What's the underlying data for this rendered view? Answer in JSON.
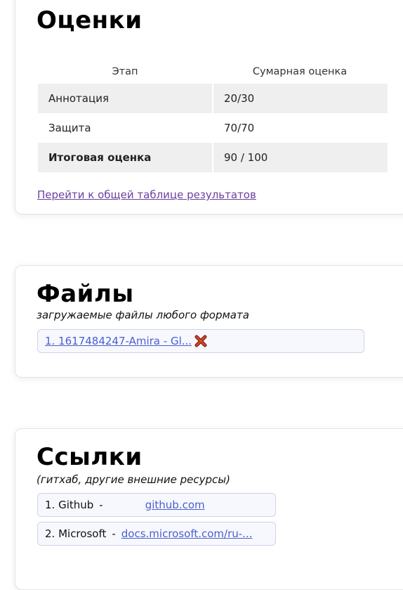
{
  "grades": {
    "title": "Оценки",
    "header": {
      "stage": "Этап",
      "total": "Сумарная оценка"
    },
    "rows": [
      {
        "stage": "Аннотация",
        "score": "20/30"
      },
      {
        "stage": "Защита",
        "score": "70/70"
      },
      {
        "stage": "Итоговая оценка",
        "score": "90 / 100"
      }
    ],
    "results_link": "Перейти к общей таблице результатов"
  },
  "files": {
    "title": "Файлы",
    "subtitle": "загружаемые файлы любого формата",
    "items": [
      {
        "label": "1. 1617484247-Amira - Gl...",
        "icon": "close-icon"
      }
    ]
  },
  "links": {
    "title": "Ссылки",
    "subtitle": "(гитхаб, другие внешние ресурсы)",
    "items": [
      {
        "number": "1. Github",
        "separator": "-",
        "url": "github.com"
      },
      {
        "number": "2. Microsoft",
        "separator": "-",
        "url": "docs.microsoft.com/ru-..."
      }
    ]
  },
  "colors": {
    "link_visited": "#6b3fa0",
    "link": "#4a5fcf",
    "delete_icon": "#c0392b"
  }
}
